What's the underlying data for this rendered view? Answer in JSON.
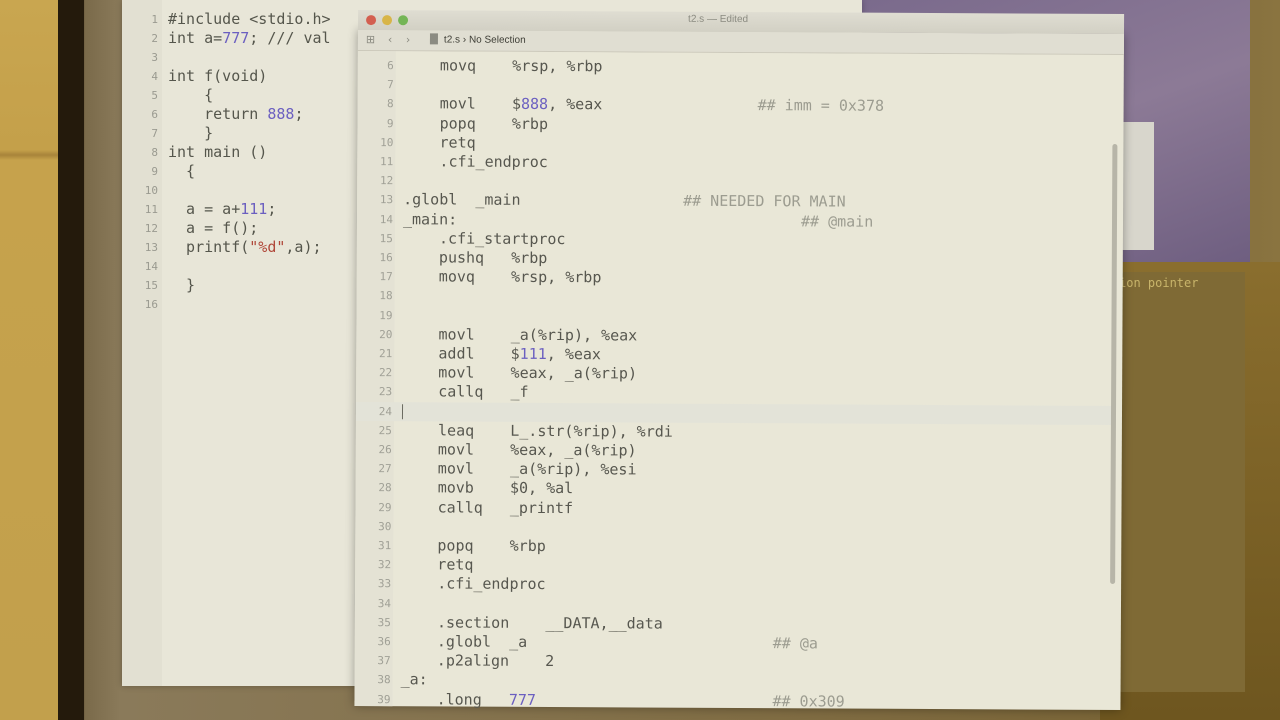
{
  "left_editor": {
    "lines": [
      {
        "n": "1",
        "code": "#include <stdio.h>"
      },
      {
        "n": "2",
        "code": "int a=777; /// val"
      },
      {
        "n": "3",
        "code": ""
      },
      {
        "n": "4",
        "code": "int f(void)"
      },
      {
        "n": "5",
        "code": "    {"
      },
      {
        "n": "6",
        "code": "    return 888;"
      },
      {
        "n": "7",
        "code": "    }"
      },
      {
        "n": "8",
        "code": "int main ()"
      },
      {
        "n": "9",
        "code": "  {"
      },
      {
        "n": "10",
        "code": ""
      },
      {
        "n": "11",
        "code": "  a = a+111;"
      },
      {
        "n": "12",
        "code": "  a = f();"
      },
      {
        "n": "13",
        "code": "  printf(\"%d\",a);"
      },
      {
        "n": "14",
        "code": ""
      },
      {
        "n": "15",
        "code": "  }"
      },
      {
        "n": "16",
        "code": ""
      }
    ]
  },
  "asm_window": {
    "title": "t2.s — Edited",
    "jumpbar_file": "t2.s",
    "jumpbar_selection": "No Selection",
    "lines": [
      {
        "n": "6",
        "code": "    movq    %rsp, %rbp",
        "comment": ""
      },
      {
        "n": "7",
        "code": "",
        "comment": ""
      },
      {
        "n": "8",
        "code": "    movl    $888, %eax",
        "comment": "## imm = 0x378"
      },
      {
        "n": "9",
        "code": "    popq    %rbp",
        "comment": ""
      },
      {
        "n": "10",
        "code": "    retq",
        "comment": ""
      },
      {
        "n": "11",
        "code": "    .cfi_endproc",
        "comment": ""
      },
      {
        "n": "12",
        "code": "",
        "comment": ""
      },
      {
        "n": "13",
        "code": ".globl  _main",
        "comment": "## NEEDED FOR MAIN"
      },
      {
        "n": "14",
        "code": "_main:",
        "comment": "## @main"
      },
      {
        "n": "15",
        "code": "    .cfi_startproc",
        "comment": ""
      },
      {
        "n": "16",
        "code": "    pushq   %rbp",
        "comment": ""
      },
      {
        "n": "17",
        "code": "    movq    %rsp, %rbp",
        "comment": ""
      },
      {
        "n": "18",
        "code": "",
        "comment": ""
      },
      {
        "n": "19",
        "code": "",
        "comment": ""
      },
      {
        "n": "20",
        "code": "    movl    _a(%rip), %eax",
        "comment": ""
      },
      {
        "n": "21",
        "code": "    addl    $111, %eax",
        "comment": ""
      },
      {
        "n": "22",
        "code": "    movl    %eax, _a(%rip)",
        "comment": ""
      },
      {
        "n": "23",
        "code": "    callq   _f",
        "comment": ""
      },
      {
        "n": "24",
        "code": "",
        "comment": ""
      },
      {
        "n": "25",
        "code": "    leaq    L_.str(%rip), %rdi",
        "comment": ""
      },
      {
        "n": "26",
        "code": "    movl    %eax, _a(%rip)",
        "comment": ""
      },
      {
        "n": "27",
        "code": "    movl    _a(%rip), %esi",
        "comment": ""
      },
      {
        "n": "28",
        "code": "    movb    $0, %al",
        "comment": ""
      },
      {
        "n": "29",
        "code": "    callq   _printf",
        "comment": ""
      },
      {
        "n": "30",
        "code": "",
        "comment": ""
      },
      {
        "n": "31",
        "code": "    popq    %rbp",
        "comment": ""
      },
      {
        "n": "32",
        "code": "    retq",
        "comment": ""
      },
      {
        "n": "33",
        "code": "    .cfi_endproc",
        "comment": ""
      },
      {
        "n": "34",
        "code": "",
        "comment": ""
      },
      {
        "n": "35",
        "code": "    .section    __DATA,__data",
        "comment": ""
      },
      {
        "n": "36",
        "code": "    .globl  _a",
        "comment": "## @a"
      },
      {
        "n": "37",
        "code": "    .p2align    2",
        "comment": ""
      },
      {
        "n": "38",
        "code": "_a:",
        "comment": ""
      },
      {
        "n": "39",
        "code": "    .long   777",
        "comment": "## 0x309"
      }
    ]
  },
  "right_pane": {
    "text": "ion pointer"
  },
  "icons": [
    "grid-icon",
    "back-arrow-icon",
    "forward-arrow-icon",
    "file-icon"
  ],
  "colors": {
    "number": "#6b5fc0",
    "string": "#b0483a",
    "editor_bg": "#e9e7d7"
  }
}
